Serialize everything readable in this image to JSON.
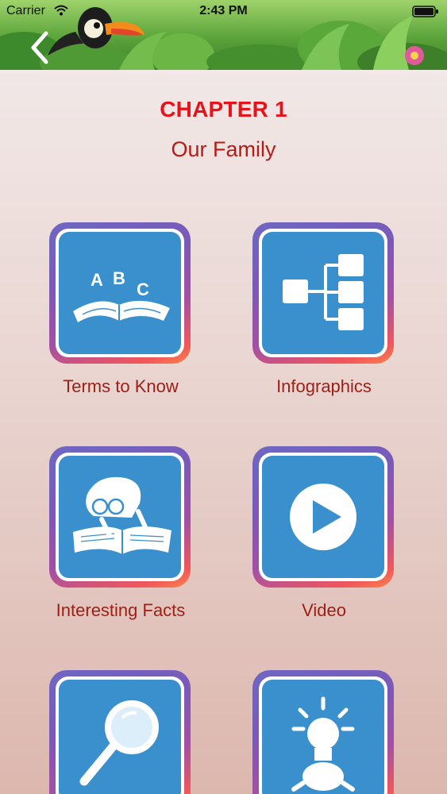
{
  "status_bar": {
    "carrier": "Carrier",
    "time": "2:43 PM",
    "icons": [
      "wifi-icon",
      "battery-icon"
    ]
  },
  "header": {
    "back_icon": "chevron-left-icon"
  },
  "chapter": {
    "title": "CHAPTER 1",
    "subtitle": "Our Family"
  },
  "tiles": [
    {
      "label": "Terms to Know",
      "icon": "open-book-abc-icon"
    },
    {
      "label": "Infographics",
      "icon": "hierarchy-diagram-icon"
    },
    {
      "label": "Interesting Facts",
      "icon": "reader-with-book-icon"
    },
    {
      "label": "Video",
      "icon": "play-icon"
    },
    {
      "label": "",
      "icon": "magnifying-glass-icon"
    },
    {
      "label": "",
      "icon": "lightbulb-icon"
    }
  ],
  "colors": {
    "title_red": "#e5141b",
    "label_brown": "#9c1f15",
    "tile_blue": "#3a8fcd"
  }
}
